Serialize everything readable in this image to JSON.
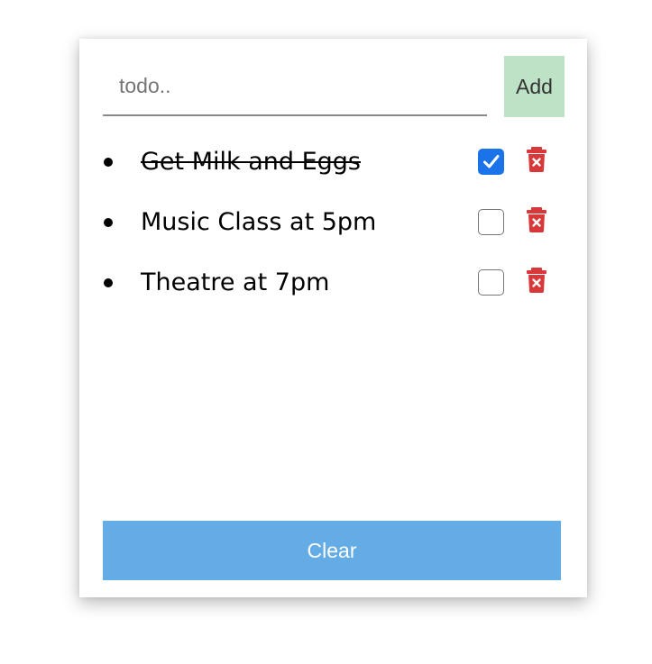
{
  "input": {
    "placeholder": "todo..",
    "value": ""
  },
  "add_button": {
    "label": "Add",
    "color": "#bde2c6"
  },
  "todos": [
    {
      "text": "Get Milk and Eggs",
      "done": true
    },
    {
      "text": "Music Class at 5pm",
      "done": false
    },
    {
      "text": "Theatre at 7pm",
      "done": false
    }
  ],
  "clear_button": {
    "label": "Clear",
    "color": "#63ace5"
  },
  "colors": {
    "checkbox_checked": "#1a73e8",
    "delete_icon": "#d9383a"
  },
  "icons": {
    "delete": "trash-icon",
    "checked": "check-icon"
  }
}
